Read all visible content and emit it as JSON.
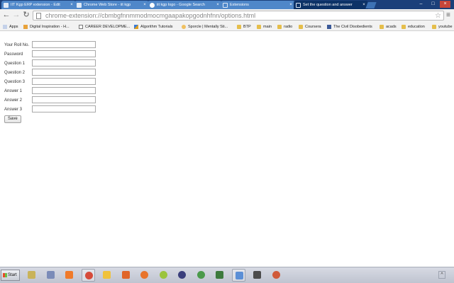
{
  "browser": {
    "tabs": [
      {
        "label": "IIT Kgp ERP extension - Edit",
        "icon": "blogger-page-icon"
      },
      {
        "label": "Chrome Web Store - iit kgp",
        "icon": "web-store-icon"
      },
      {
        "label": "iit kgp logo - Google Search",
        "icon": "google-icon"
      },
      {
        "label": "Extensions",
        "icon": "blank-page-icon"
      },
      {
        "label": "Set the question and answer",
        "icon": "blank-page-icon"
      }
    ],
    "close_glyph": "×",
    "window_buttons": {
      "minimize": "–",
      "maximize": "□",
      "close": "×"
    },
    "nav": {
      "back": "←",
      "forward": "→",
      "reload": "↻",
      "menu": "≡",
      "star": "☆"
    },
    "url": "chrome-extension://cbmbgfnnmmodmocmgaapakopgodnhfnn/options.html"
  },
  "bookmarks": [
    {
      "label": "Apps",
      "icon": "apps-grid-icon"
    },
    {
      "label": "Digital Inspiration - H...",
      "icon": "di-icon"
    },
    {
      "label": "CAREER DEVELOPME...",
      "icon": "page-icon"
    },
    {
      "label": "Algorithm Tutorials",
      "icon": "algorithm-icon"
    },
    {
      "label": "Sporcle | Mentally Sti...",
      "icon": "sporcle-icon"
    },
    {
      "label": "BTP",
      "icon": "folder-icon"
    },
    {
      "label": "main",
      "icon": "folder-icon"
    },
    {
      "label": "radio",
      "icon": "folder-icon"
    },
    {
      "label": "Coursera",
      "icon": "folder-icon"
    },
    {
      "label": "The Civil Disobedients",
      "icon": "facebook-icon"
    },
    {
      "label": "acads",
      "icon": "folder-icon"
    },
    {
      "label": "education",
      "icon": "folder-icon"
    },
    {
      "label": "youtube",
      "icon": "folder-icon"
    }
  ],
  "form": {
    "fields": [
      {
        "label": "Your Roll No.",
        "value": ""
      },
      {
        "label": "Password",
        "value": ""
      },
      {
        "label": "Question 1",
        "value": ""
      },
      {
        "label": "Question 2",
        "value": ""
      },
      {
        "label": "Question 3",
        "value": ""
      },
      {
        "label": "Answer 1",
        "value": ""
      },
      {
        "label": "Answer 2",
        "value": ""
      },
      {
        "label": "Answer 3",
        "value": ""
      }
    ],
    "save_label": "Save"
  },
  "taskbar": {
    "start_label": "Start",
    "tray_chevron": "^",
    "pinned": [
      {
        "icon": "file-manager-icon",
        "color": "#c9b35a"
      },
      {
        "icon": "apps-grid-icon",
        "color": "#7a8bb8"
      },
      {
        "icon": "xampp-icon",
        "color": "#f07a2a"
      },
      {
        "icon": "chrome-icon",
        "color": "#d64b3b"
      },
      {
        "icon": "paint-icon",
        "color": "#f0c23c"
      },
      {
        "icon": "matlab-icon",
        "color": "#e0652a"
      },
      {
        "icon": "firefox-icon",
        "color": "#e8742c"
      },
      {
        "icon": "pidgin-icon",
        "color": "#9bc43d"
      },
      {
        "icon": "eclipse-icon",
        "color": "#3b3f7c"
      },
      {
        "icon": "globe-icon",
        "color": "#4b9a4b"
      },
      {
        "icon": "terminal-icon",
        "color": "#3d7a3d"
      },
      {
        "icon": "media-player-icon",
        "color": "#5b8fd6"
      },
      {
        "icon": "sublime-text-icon",
        "color": "#4b4b4b"
      },
      {
        "icon": "search-tool-icon",
        "color": "#d05a3a"
      }
    ]
  },
  "colors": {
    "tab_strip": "#1b3f7a",
    "tab": "#4f87c9",
    "tab_active": "#0c3267",
    "toolbar": "#f2f2f2",
    "taskbar": "#c9cdd6"
  }
}
